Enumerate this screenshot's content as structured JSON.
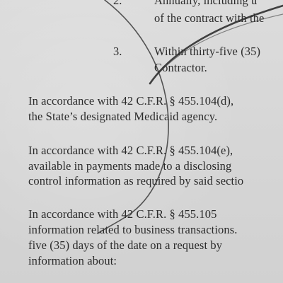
{
  "list": {
    "item2": {
      "number": "2.",
      "line1": "Annually, including u",
      "line2": "of the contract with the"
    },
    "item3": {
      "number": "3.",
      "line1": "Within thirty-five (35)",
      "line2": "Contractor."
    }
  },
  "paragraphs": [
    {
      "lines": [
        "In accordance with 42 C.F.R. § 455.104(d),",
        "the State’s designated Medicaid agency."
      ]
    },
    {
      "lines": [
        "In accordance with 42 C.F.R. § 455.104(e),",
        "available in payments made to a disclosing",
        "control information as required by said sectio"
      ]
    },
    {
      "lines": [
        "In accordance with 42 C.F.R. § 455.105",
        "information related to business transactions.",
        "five (35) days of the date on a request by",
        "information about:"
      ]
    }
  ],
  "colors": {
    "paper": "#d9d9d9",
    "ink": "#2b2b2b",
    "pen_stroke": "#3a3a3a"
  }
}
